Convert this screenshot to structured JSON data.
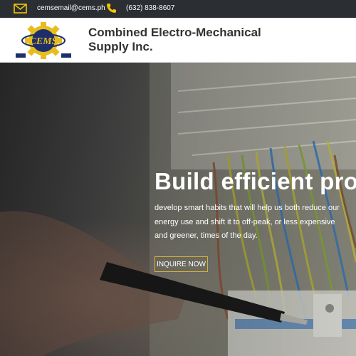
{
  "topbar": {
    "email": "cemsemail@cems.ph",
    "phone": "(632) 838-8607",
    "icon_color": "#f2c500"
  },
  "header": {
    "logo_text": "CEMS",
    "company_name_line1": "Combined Electro-Mechanical",
    "company_name_line2": "Supply Inc."
  },
  "hero": {
    "title": "Build efficient pro",
    "text": "develop smart habits that will help us both reduce our energy use and shift it to off-peak, or less expensive and greener, times of the day.",
    "button_label": "INQUIRE NOW",
    "accent_color": "#d4b13a"
  }
}
